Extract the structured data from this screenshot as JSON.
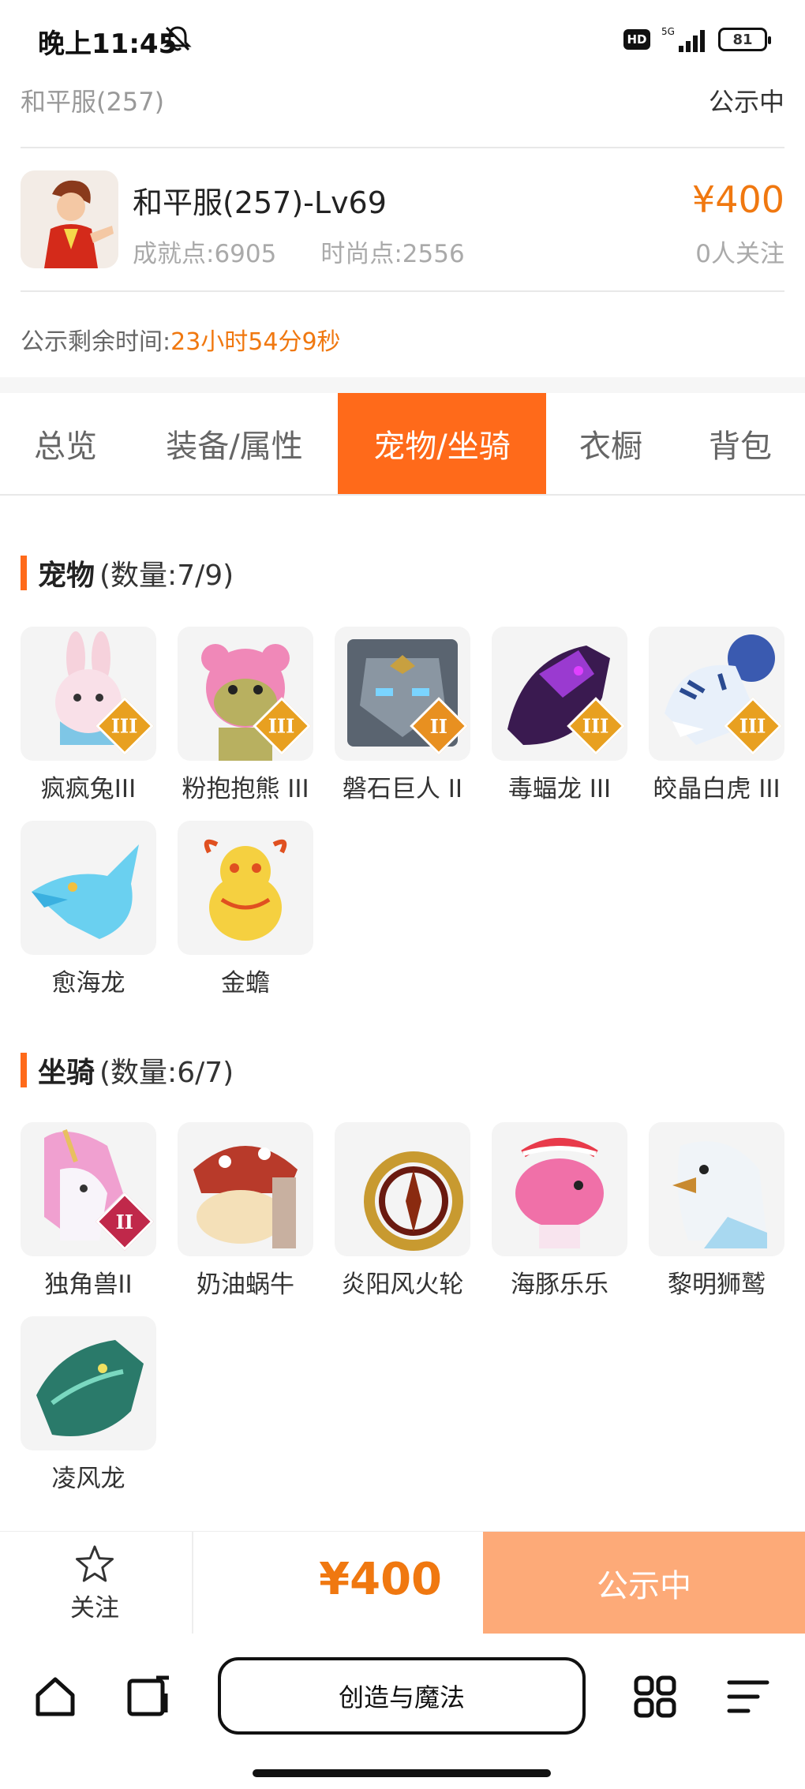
{
  "status_bar": {
    "time": "晚上11:45",
    "hd": "HD",
    "network": "5G",
    "battery": "81"
  },
  "header": {
    "server": "和平服(257)",
    "status": "公示中",
    "character_title": "和平服(257)-Lv69",
    "achievement": "成就点:6905",
    "fashion": "时尚点:2556",
    "price": "¥400",
    "followers": "0人关注",
    "remaining_label": "公示剩余时间:",
    "remaining_time": "23小时54分9秒"
  },
  "tabs": [
    {
      "label": "总览"
    },
    {
      "label": "装备/属性"
    },
    {
      "label": "宠物/坐骑"
    },
    {
      "label": "衣橱"
    },
    {
      "label": "背包"
    }
  ],
  "pets": {
    "title": "宠物",
    "count": "(数量:7/9)",
    "items": [
      {
        "name": "疯疯兔III",
        "rank": "III"
      },
      {
        "name": "粉抱抱熊 III",
        "rank": "III"
      },
      {
        "name": "磐石巨人 II",
        "rank": "II"
      },
      {
        "name": "毒蝠龙 III",
        "rank": "III"
      },
      {
        "name": "皎晶白虎 III",
        "rank": "III"
      },
      {
        "name": "愈海龙",
        "rank": ""
      },
      {
        "name": "金蟾",
        "rank": ""
      }
    ]
  },
  "mounts": {
    "title": "坐骑",
    "count": "(数量:6/7)",
    "items": [
      {
        "name": "独角兽II",
        "rank": "II"
      },
      {
        "name": "奶油蜗牛",
        "rank": ""
      },
      {
        "name": "炎阳风火轮",
        "rank": ""
      },
      {
        "name": "海豚乐乐",
        "rank": ""
      },
      {
        "name": "黎明狮鹫",
        "rank": ""
      },
      {
        "name": "凌风龙",
        "rank": ""
      }
    ]
  },
  "action_bar": {
    "follow_label": "关注",
    "price": "¥400",
    "status_button": "公示中"
  },
  "browser_nav": {
    "center_label": "创造与魔法"
  },
  "colors": {
    "accent": "#ff6a1a",
    "price": "#f07810",
    "status_button": "#fdaa78"
  }
}
